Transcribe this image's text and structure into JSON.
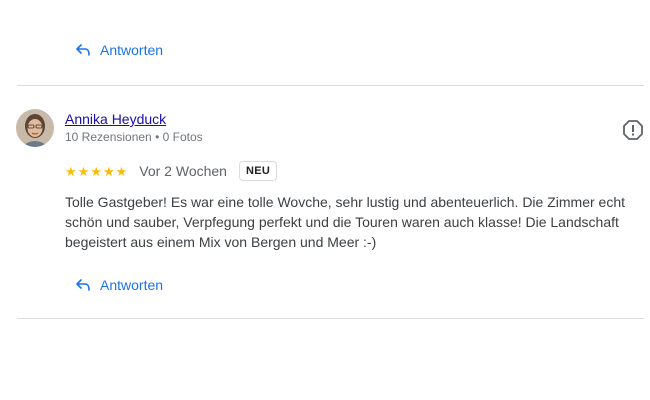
{
  "previous_review": {
    "reply_label": "Antworten",
    "reply_icon": "reply-icon"
  },
  "review": {
    "author_name": "Annika Heyduck",
    "author_meta": "10 Rezensionen • 0 Fotos",
    "rating": 5,
    "rating_max": 5,
    "time_ago": "Vor 2 Wochen",
    "badge": "NEU",
    "text": "Tolle Gastgeber! Es war eine tolle Wovche, sehr lustig und abenteuerlich. Die Zimmer echt schön und sauber, Verpfegung perfekt und die Touren waren auch klasse! Die Landschaft begeistert aus einem Mix von Bergen und Meer :-)",
    "reply_label": "Antworten",
    "reply_icon": "reply-icon",
    "report_icon": "report-icon"
  },
  "colors": {
    "link": "#1a0dab",
    "accent": "#1a73e8",
    "star": "#fbbc04",
    "divider": "#dadce0",
    "meta_text": "#70757a"
  }
}
